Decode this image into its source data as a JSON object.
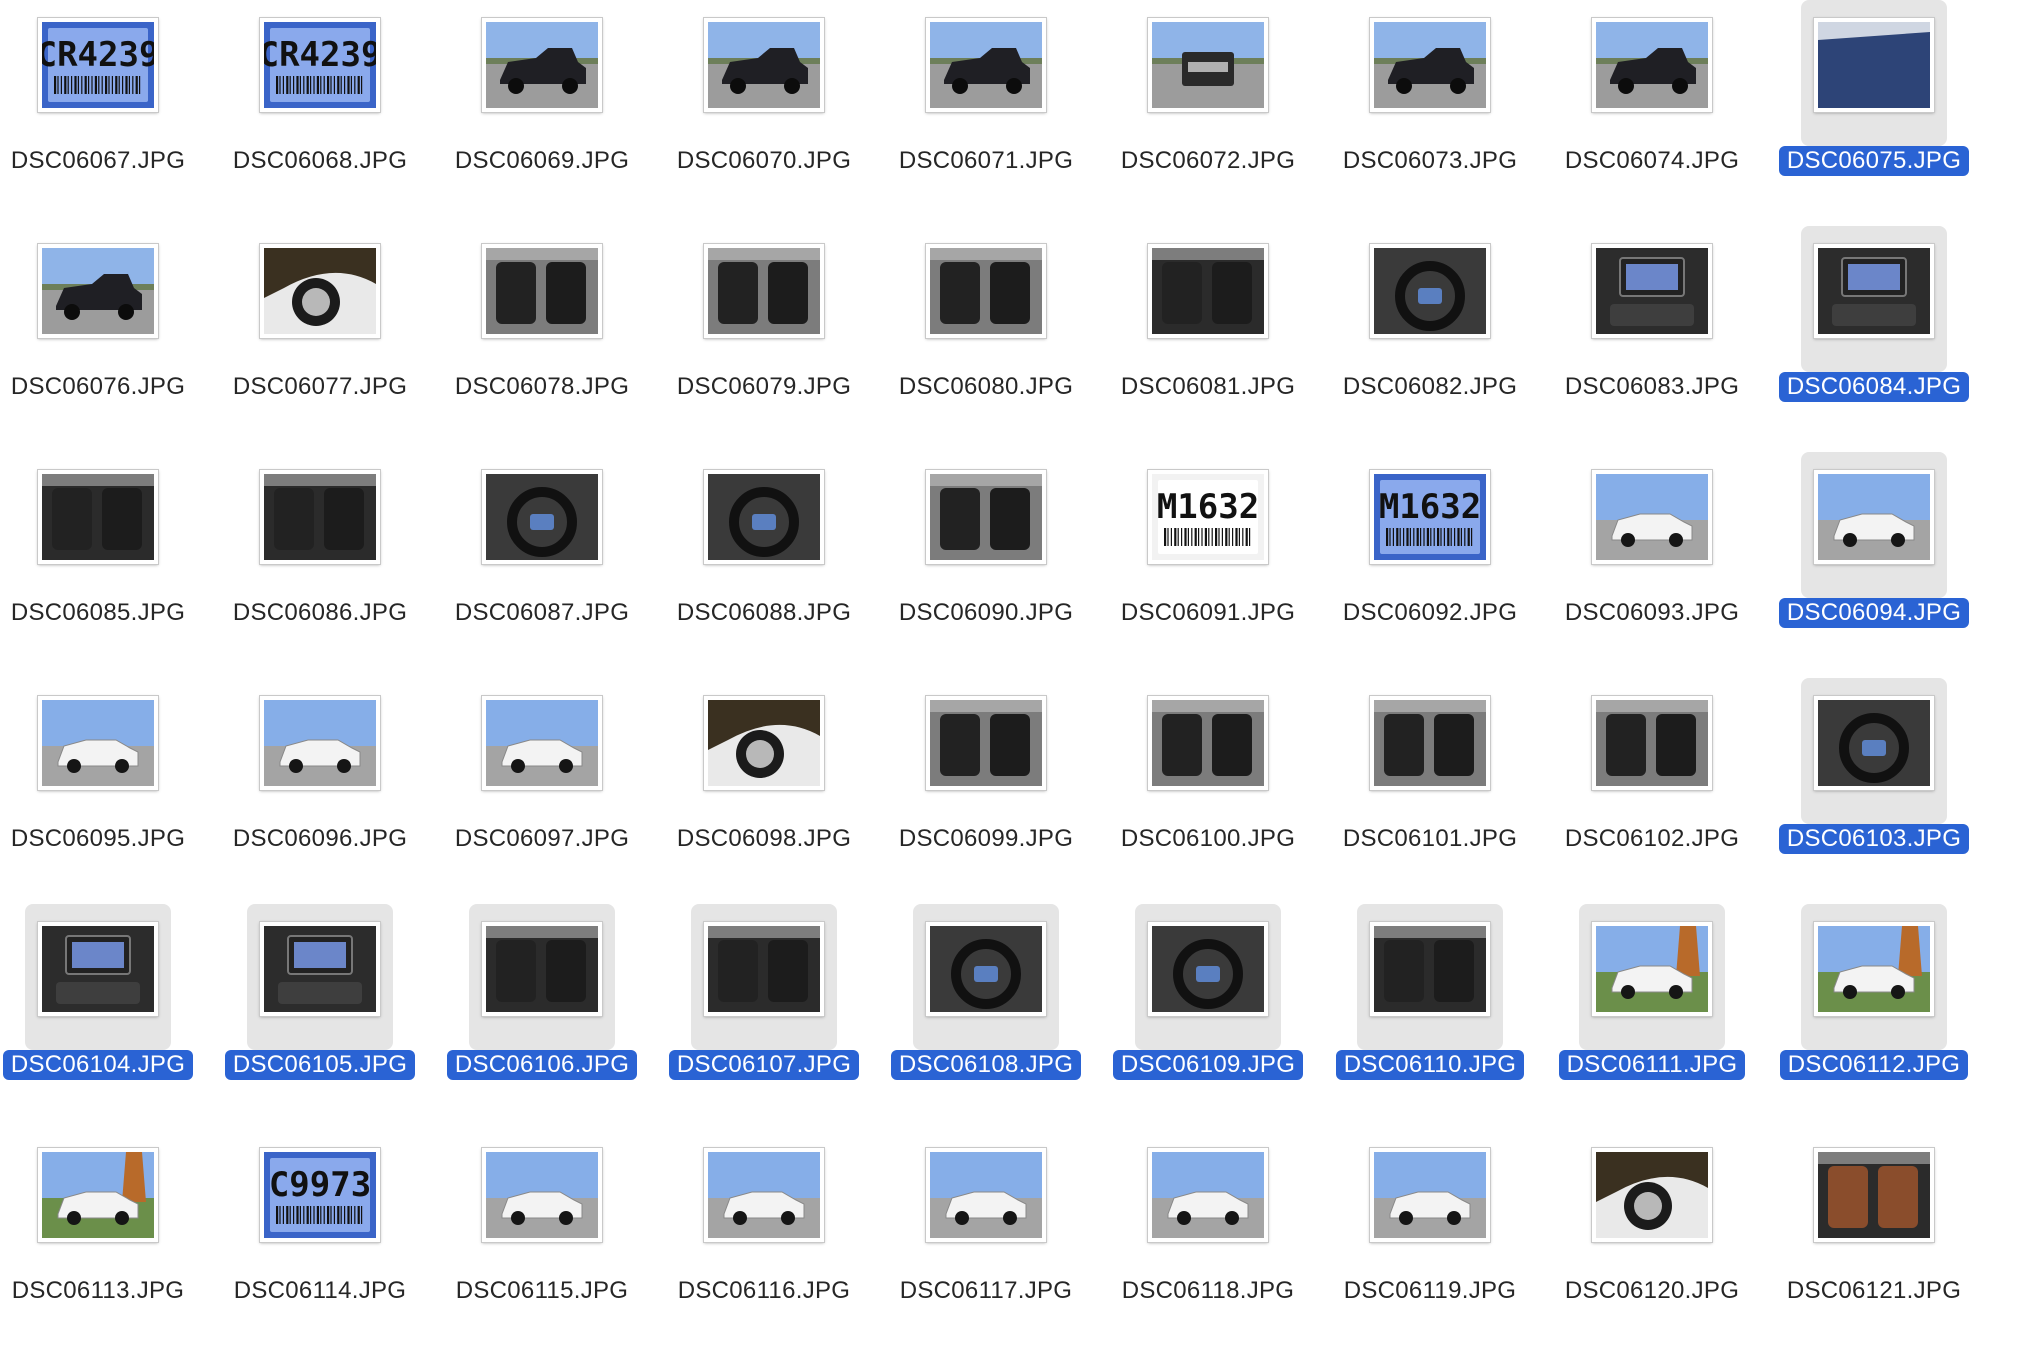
{
  "files": [
    {
      "name": "DSC06067.JPG",
      "selected": false,
      "kind": "tag",
      "tag_text": "CR4239"
    },
    {
      "name": "DSC06068.JPG",
      "selected": false,
      "kind": "tag",
      "tag_text": "CR4239"
    },
    {
      "name": "DSC06069.JPG",
      "selected": false,
      "kind": "truck"
    },
    {
      "name": "DSC06070.JPG",
      "selected": false,
      "kind": "truck"
    },
    {
      "name": "DSC06071.JPG",
      "selected": false,
      "kind": "truck"
    },
    {
      "name": "DSC06072.JPG",
      "selected": false,
      "kind": "truck-rear"
    },
    {
      "name": "DSC06073.JPG",
      "selected": false,
      "kind": "truck"
    },
    {
      "name": "DSC06074.JPG",
      "selected": false,
      "kind": "truck"
    },
    {
      "name": "DSC06075.JPG",
      "selected": true,
      "kind": "bed"
    },
    {
      "name": "DSC06076.JPG",
      "selected": false,
      "kind": "truck"
    },
    {
      "name": "DSC06077.JPG",
      "selected": false,
      "kind": "wheel"
    },
    {
      "name": "DSC06078.JPG",
      "selected": false,
      "kind": "interior"
    },
    {
      "name": "DSC06079.JPG",
      "selected": false,
      "kind": "interior"
    },
    {
      "name": "DSC06080.JPG",
      "selected": false,
      "kind": "interior"
    },
    {
      "name": "DSC06081.JPG",
      "selected": false,
      "kind": "interior-dark"
    },
    {
      "name": "DSC06082.JPG",
      "selected": false,
      "kind": "steering"
    },
    {
      "name": "DSC06083.JPG",
      "selected": false,
      "kind": "dash"
    },
    {
      "name": "DSC06084.JPG",
      "selected": true,
      "kind": "dash"
    },
    {
      "name": "DSC06085.JPG",
      "selected": false,
      "kind": "interior-dark"
    },
    {
      "name": "DSC06086.JPG",
      "selected": false,
      "kind": "interior-dark"
    },
    {
      "name": "DSC06087.JPG",
      "selected": false,
      "kind": "steering"
    },
    {
      "name": "DSC06088.JPG",
      "selected": false,
      "kind": "steering"
    },
    {
      "name": "DSC06090.JPG",
      "selected": false,
      "kind": "interior"
    },
    {
      "name": "DSC06091.JPG",
      "selected": false,
      "kind": "tag-white",
      "tag_text": "M1632"
    },
    {
      "name": "DSC06092.JPG",
      "selected": false,
      "kind": "tag",
      "tag_text": "M1632"
    },
    {
      "name": "DSC06093.JPG",
      "selected": false,
      "kind": "suv-white"
    },
    {
      "name": "DSC06094.JPG",
      "selected": true,
      "kind": "suv-white"
    },
    {
      "name": "DSC06095.JPG",
      "selected": false,
      "kind": "suv-white"
    },
    {
      "name": "DSC06096.JPG",
      "selected": false,
      "kind": "suv-white"
    },
    {
      "name": "DSC06097.JPG",
      "selected": false,
      "kind": "suv-white"
    },
    {
      "name": "DSC06098.JPG",
      "selected": false,
      "kind": "wheel"
    },
    {
      "name": "DSC06099.JPG",
      "selected": false,
      "kind": "interior"
    },
    {
      "name": "DSC06100.JPG",
      "selected": false,
      "kind": "interior"
    },
    {
      "name": "DSC06101.JPG",
      "selected": false,
      "kind": "interior"
    },
    {
      "name": "DSC06102.JPG",
      "selected": false,
      "kind": "interior"
    },
    {
      "name": "DSC06103.JPG",
      "selected": true,
      "kind": "steering"
    },
    {
      "name": "DSC06104.JPG",
      "selected": true,
      "kind": "dash"
    },
    {
      "name": "DSC06105.JPG",
      "selected": true,
      "kind": "dash"
    },
    {
      "name": "DSC06106.JPG",
      "selected": true,
      "kind": "interior-dark"
    },
    {
      "name": "DSC06107.JPG",
      "selected": true,
      "kind": "interior-dark"
    },
    {
      "name": "DSC06108.JPG",
      "selected": true,
      "kind": "steering"
    },
    {
      "name": "DSC06109.JPG",
      "selected": true,
      "kind": "steering"
    },
    {
      "name": "DSC06110.JPG",
      "selected": true,
      "kind": "interior-dark"
    },
    {
      "name": "DSC06111.JPG",
      "selected": true,
      "kind": "suv-lot"
    },
    {
      "name": "DSC06112.JPG",
      "selected": true,
      "kind": "suv-lot"
    },
    {
      "name": "DSC06113.JPG",
      "selected": false,
      "kind": "suv-lot"
    },
    {
      "name": "DSC06114.JPG",
      "selected": false,
      "kind": "tag",
      "tag_text": "C9973"
    },
    {
      "name": "DSC06115.JPG",
      "selected": false,
      "kind": "suv-white"
    },
    {
      "name": "DSC06116.JPG",
      "selected": false,
      "kind": "suv-white"
    },
    {
      "name": "DSC06117.JPG",
      "selected": false,
      "kind": "suv-white"
    },
    {
      "name": "DSC06118.JPG",
      "selected": false,
      "kind": "suv-white"
    },
    {
      "name": "DSC06119.JPG",
      "selected": false,
      "kind": "suv-white"
    },
    {
      "name": "DSC06120.JPG",
      "selected": false,
      "kind": "wheel"
    },
    {
      "name": "DSC06121.JPG",
      "selected": false,
      "kind": "interior-brown"
    }
  ]
}
